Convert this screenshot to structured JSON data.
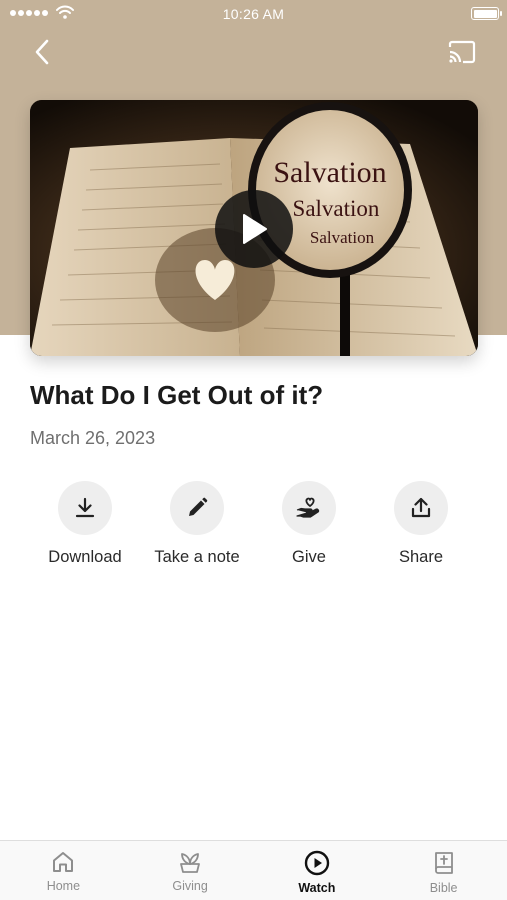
{
  "status_bar": {
    "time": "10:26 AM"
  },
  "header": {
    "back_icon": "chevron-left-icon",
    "cast_icon": "cast-icon",
    "background_color": "#c4b299"
  },
  "video": {
    "thumbnail_text": [
      "Salvation",
      "Salvation",
      "Salvation"
    ],
    "play_icon": "play-icon"
  },
  "sermon": {
    "title": "What Do I Get Out of it?",
    "date": "March 26, 2023"
  },
  "actions": [
    {
      "label": "Download",
      "icon": "download-icon"
    },
    {
      "label": "Take a note",
      "icon": "pencil-icon"
    },
    {
      "label": "Give",
      "icon": "hand-heart-icon"
    },
    {
      "label": "Share",
      "icon": "share-icon"
    }
  ],
  "tab_bar": {
    "active_tab": "Watch",
    "tabs": [
      {
        "label": "Home",
        "icon": "home-icon"
      },
      {
        "label": "Giving",
        "icon": "plant-icon"
      },
      {
        "label": "Watch",
        "icon": "play-circle-icon"
      },
      {
        "label": "Bible",
        "icon": "bible-icon"
      }
    ]
  },
  "colors": {
    "header_background": "#c4b299",
    "action_circle": "#eeeeee",
    "active_tab": "#111111",
    "inactive_tab": "#8e8e8e"
  }
}
